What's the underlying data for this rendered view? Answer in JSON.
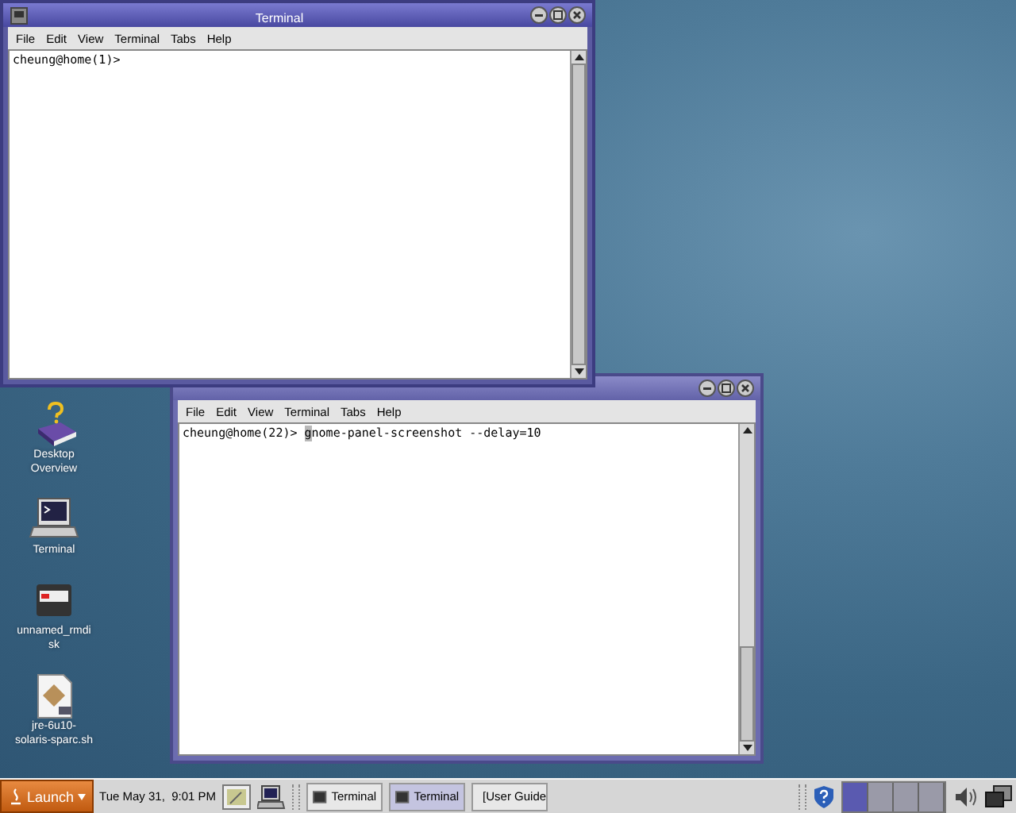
{
  "windows": [
    {
      "title": "Terminal",
      "focused": true,
      "menu": [
        "File",
        "Edit",
        "View",
        "Terminal",
        "Tabs",
        "Help"
      ],
      "lines": [
        {
          "prompt": "cheung@home(1)>"
        }
      ]
    },
    {
      "focused": false,
      "menu": [
        "File",
        "Edit",
        "View",
        "Terminal",
        "Tabs",
        "Help"
      ],
      "lines": [
        {
          "prompt": "cheung@home(22)>",
          "input": "gnome-panel-screenshot --delay=10",
          "cursor": true
        }
      ]
    }
  ],
  "desktop_icons": [
    {
      "kind": "book",
      "label": "Desktop Overview"
    },
    {
      "kind": "terminal",
      "label": "Terminal"
    },
    {
      "kind": "disk",
      "label": "unnamed_rmdisk"
    },
    {
      "kind": "file",
      "label": "jre-6u10-solaris-sparc.sh"
    }
  ],
  "taskbar": {
    "launch": "Launch",
    "clock": "Tue May 31,  9:01 PM",
    "tasks": [
      {
        "label": "Terminal",
        "kind": "terminal",
        "selected": false
      },
      {
        "label": "Terminal",
        "kind": "terminal",
        "selected": true
      },
      {
        "label": "[User Guide",
        "kind": "document",
        "selected": false
      }
    ],
    "workspaces": [
      {
        "selected": true
      },
      {
        "selected": false
      },
      {
        "selected": false
      },
      {
        "selected": false
      }
    ]
  }
}
